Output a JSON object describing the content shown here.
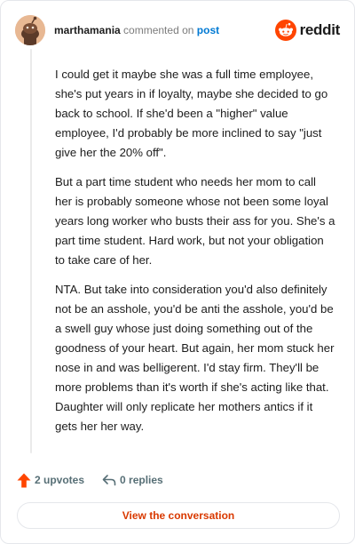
{
  "comment": {
    "username": "marthamania",
    "action_text": "commented on",
    "post_link": "post",
    "avatar_icon": "snoo-avatar-icon",
    "paragraphs": [
      "I could get it maybe she was a full time employee, she's put years in if loyalty, maybe she decided to go back to school. If she'd been a \"higher\" value employee, I'd probably be more inclined to say \"just give her the 20% off\".",
      "But a part time student who needs her mom to call her is probably someone whose not been some loyal years long worker who busts their ass for you. She's a part time student. Hard work, but not your obligation to take care of her.",
      "NTA. But take into consideration you'd also definitely not be an asshole, you'd be anti the asshole, you'd be a swell guy whose just doing something out of the goodness of your heart. But again, her mom stuck her nose in and was belligerent. I'd stay firm. They'll be more problems than it's worth if she's acting like that. Daughter will only replicate her mothers antics if it gets her her way."
    ]
  },
  "brand": {
    "name": "reddit",
    "icon": "reddit-logo-icon",
    "color": "#ff4500"
  },
  "footer": {
    "upvotes": "2 upvotes",
    "replies": "0 replies",
    "upvote_icon": "upvote-arrow-icon",
    "reply_icon": "reply-arrow-icon",
    "view_button": "View the conversation"
  },
  "colors": {
    "accent": "#d93900",
    "link": "#0079d3",
    "upvote": "#ff4500",
    "muted": "#576f76"
  }
}
